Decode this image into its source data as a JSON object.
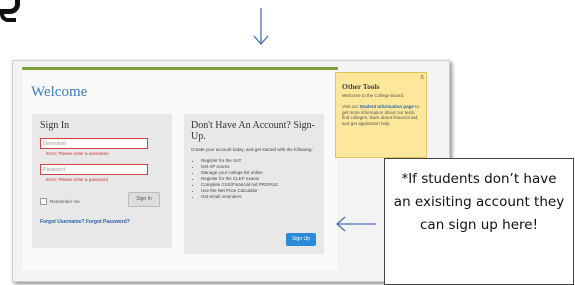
{
  "welcome_title": "Welcome",
  "signin": {
    "title": "Sign In",
    "username_placeholder": "Username",
    "username_error": "Error: Please enter a username",
    "password_placeholder": "Password",
    "password_error": "Error: Please enter a password",
    "remember_label": "Remember me",
    "signin_button": "Sign In",
    "forgot_link": "Forgot Username? Forgot Password?"
  },
  "signup": {
    "title": "Don't Have An Account? Sign-Up.",
    "intro": "Create your account today, and get started with the following:",
    "items": [
      "Register for the SAT",
      "Get AP scores",
      "Manage your college list online",
      "Register for the CLEP exams",
      "Complete CSS/Financial Aid PROFILE",
      "Use the Net Price Calculator",
      "Get email reminders"
    ],
    "button": "Sign Up"
  },
  "other_tools": {
    "title": "Other Tools",
    "line1": "Welcome to the College Board.",
    "line2_pre": "Visit our ",
    "link": "Student Information page",
    "line2_post": " to get more information about our tests, find colleges, learn about financial aid, and get application help.",
    "close": "x"
  },
  "callout_text": "*If students don’t have an exisiting account they can sign up here!"
}
